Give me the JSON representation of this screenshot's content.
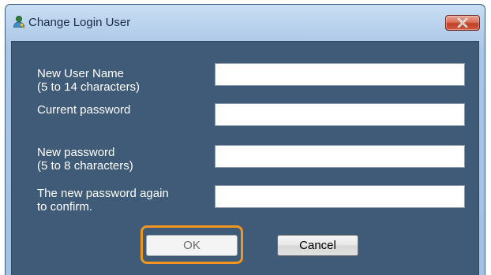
{
  "window": {
    "title": "Change Login User",
    "icons": {
      "app": "user-key-icon",
      "close": "close-icon"
    }
  },
  "form": {
    "new_user_name": {
      "label_line1": "New User Name",
      "label_line2": "(5 to 14 characters)",
      "value": ""
    },
    "current_password": {
      "label_line1": "Current password",
      "value": ""
    },
    "new_password": {
      "label_line1": "New password",
      "label_line2": "(5 to 8 characters)",
      "value": ""
    },
    "confirm_password": {
      "label_line1": "The new password again",
      "label_line2": "to confirm.",
      "value": ""
    }
  },
  "buttons": {
    "ok_label": "OK",
    "cancel_label": "Cancel"
  },
  "colors": {
    "dialog_body": "#3f5b78",
    "highlight": "#f0961e",
    "close_button": "#c2402a"
  }
}
